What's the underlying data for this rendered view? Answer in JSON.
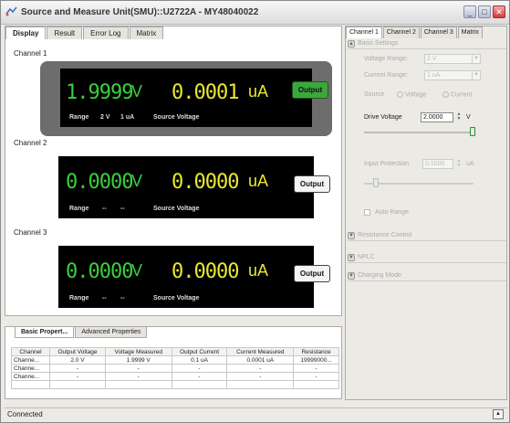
{
  "window": {
    "title": "Source and Measure Unit(SMU)::U2722A - MY48040022"
  },
  "left_tabs": [
    "Display",
    "Result",
    "Error Log",
    "Matrix"
  ],
  "channels": [
    {
      "label": "Channel 1",
      "voltage": "1.9999",
      "voltage_unit": "V",
      "current": "0.0001",
      "current_unit": "uA",
      "range_label": "Range",
      "range_v": "2 V",
      "range_i": "1 uA",
      "mode": "Source Voltage",
      "output_label": "Output",
      "output_on": true
    },
    {
      "label": "Channel 2",
      "voltage": "0.0000",
      "voltage_unit": "V",
      "current": "0.0000",
      "current_unit": "uA",
      "range_label": "Range",
      "range_v": "--",
      "range_i": "--",
      "mode": "Source Voltage",
      "output_label": "Output",
      "output_on": false
    },
    {
      "label": "Channel 3",
      "voltage": "0.0000",
      "voltage_unit": "V",
      "current": "0.0000",
      "current_unit": "uA",
      "range_label": "Range",
      "range_v": "--",
      "range_i": "--",
      "mode": "Source Voltage",
      "output_label": "Output",
      "output_on": false
    }
  ],
  "bottom_tabs": [
    "Basic Propert...",
    "Advanced Properties"
  ],
  "table": {
    "headers": [
      "Channel",
      "Output Voltage",
      "Voltage Measured",
      "Output Current",
      "Current Measured",
      "Resistance"
    ],
    "rows": [
      [
        "Channe...",
        "2.0 V",
        "1.9999 V",
        "0.1 uA",
        "0.0001 uA",
        "19999000..."
      ],
      [
        "Channe...",
        "-",
        "-",
        "-",
        "-",
        "-"
      ],
      [
        "Channe...",
        "-",
        "-",
        "-",
        "-",
        "-"
      ]
    ]
  },
  "right_tabs": [
    "Channel 1",
    "Channel 2",
    "Channel 3",
    "Matrix"
  ],
  "right": {
    "basic_settings": "Basic Settings",
    "voltage_range_label": "Voltage Range:",
    "voltage_range_value": "2 V",
    "current_range_label": "Current Range:",
    "current_range_value": "1 uA",
    "source_label": "Source",
    "source_voltage": "Voltage",
    "source_current": "Current",
    "drive_voltage_label": "Drive Voltage",
    "drive_voltage_value": "2.0000",
    "drive_voltage_unit": "V",
    "input_protection_label": "Input Protection",
    "input_protection_value": "0.1000",
    "input_protection_unit": "uA",
    "auto_range": "Auto Range",
    "collapsed_sections": [
      "Resistance Control",
      "NPLC",
      "Charging Mode"
    ]
  },
  "status": {
    "text": "Connected"
  }
}
